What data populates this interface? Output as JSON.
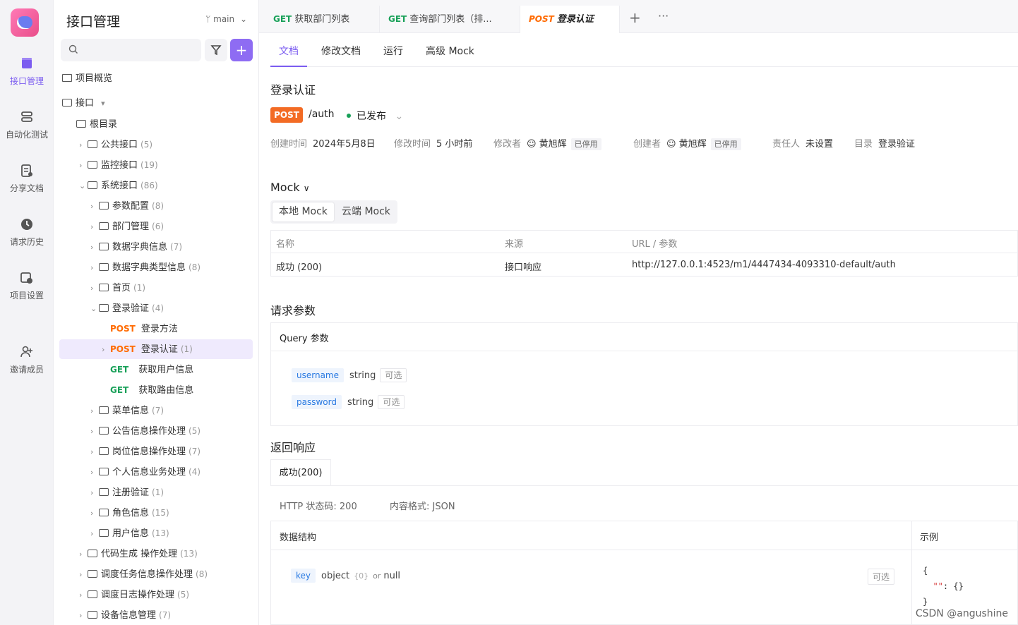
{
  "rail": {
    "items": [
      {
        "label": "接口管理",
        "icon": "api-icon"
      },
      {
        "label": "自动化测试",
        "icon": "automation-icon"
      },
      {
        "label": "分享文档",
        "icon": "share-doc-icon"
      },
      {
        "label": "请求历史",
        "icon": "history-icon"
      },
      {
        "label": "项目设置",
        "icon": "settings-icon"
      },
      {
        "label": "邀请成员",
        "icon": "invite-icon"
      }
    ]
  },
  "sidebar": {
    "title": "接口管理",
    "branch": "main",
    "overview": "项目概览",
    "api_root": "接口",
    "tree": [
      {
        "label": "根目录",
        "count": ""
      },
      {
        "label": "公共接口",
        "count": "(5)"
      },
      {
        "label": "监控接口",
        "count": "(19)"
      },
      {
        "label": "系统接口",
        "count": "(86)"
      },
      {
        "label": "参数配置",
        "count": "(8)"
      },
      {
        "label": "部门管理",
        "count": "(6)"
      },
      {
        "label": "数据字典信息",
        "count": "(7)"
      },
      {
        "label": "数据字典类型信息",
        "count": "(8)"
      },
      {
        "label": "首页",
        "count": "(1)"
      },
      {
        "label": "登录验证",
        "count": "(4)"
      },
      {
        "label": "登录方法",
        "method": "POST",
        "count": ""
      },
      {
        "label": "登录认证",
        "method": "POST",
        "count": "(1)"
      },
      {
        "label": "获取用户信息",
        "method": "GET",
        "count": ""
      },
      {
        "label": "获取路由信息",
        "method": "GET",
        "count": ""
      },
      {
        "label": "菜单信息",
        "count": "(7)"
      },
      {
        "label": "公告信息操作处理",
        "count": "(5)"
      },
      {
        "label": "岗位信息操作处理",
        "count": "(7)"
      },
      {
        "label": "个人信息业务处理",
        "count": "(4)"
      },
      {
        "label": "注册验证",
        "count": "(1)"
      },
      {
        "label": "角色信息",
        "count": "(15)"
      },
      {
        "label": "用户信息",
        "count": "(13)"
      },
      {
        "label": "代码生成 操作处理",
        "count": "(13)"
      },
      {
        "label": "调度任务信息操作处理",
        "count": "(8)"
      },
      {
        "label": "调度日志操作处理",
        "count": "(5)"
      },
      {
        "label": "设备信息管理",
        "count": "(7)"
      }
    ]
  },
  "tabs": [
    {
      "method": "GET",
      "name": "获取部门列表"
    },
    {
      "method": "GET",
      "name": "查询部门列表（排..."
    },
    {
      "method": "POST",
      "name": "登录认证"
    }
  ],
  "subtabs": [
    "文档",
    "修改文档",
    "运行",
    "高级 Mock"
  ],
  "doc": {
    "title": "登录认证",
    "method": "POST",
    "path": "/auth",
    "status": "已发布",
    "meta": {
      "created_label": "创建时间",
      "created": "2024年5月8日",
      "modified_label": "修改时间",
      "modified": "5 小时前",
      "modifier_label": "修改者",
      "modifier": "黄旭辉",
      "modifier_tag": "已停用",
      "creator_label": "创建者",
      "creator": "黄旭辉",
      "creator_tag": "已停用",
      "owner_label": "责任人",
      "owner": "未设置",
      "dir_label": "目录",
      "dir": "登录验证"
    }
  },
  "mock": {
    "title": "Mock",
    "switch": [
      "本地 Mock",
      "云端 Mock"
    ],
    "headers": [
      "名称",
      "来源",
      "URL / 参数"
    ],
    "row": {
      "name": "成功 (200)",
      "source": "接口响应",
      "url": "http://127.0.0.1:4523/m1/4447434-4093310-default/auth"
    }
  },
  "request": {
    "title": "请求参数",
    "query_title": "Query 参数",
    "params": [
      {
        "name": "username",
        "type": "string",
        "opt": "可选"
      },
      {
        "name": "password",
        "type": "string",
        "opt": "可选"
      }
    ]
  },
  "response": {
    "title": "返回响应",
    "tab": "成功(200)",
    "http_status": "HTTP 状态码: 200",
    "content_type": "内容格式: JSON",
    "struct_label": "数据结构",
    "example_label": "示例",
    "field": {
      "name": "key",
      "type": "object",
      "braces": "{0}",
      "or": "or",
      "alt": "null",
      "opt": "可选"
    }
  },
  "watermark": "CSDN @angushine",
  "colors": {
    "accent": "#7b5cf0",
    "post": "#ff6a00",
    "get": "#18a058"
  }
}
